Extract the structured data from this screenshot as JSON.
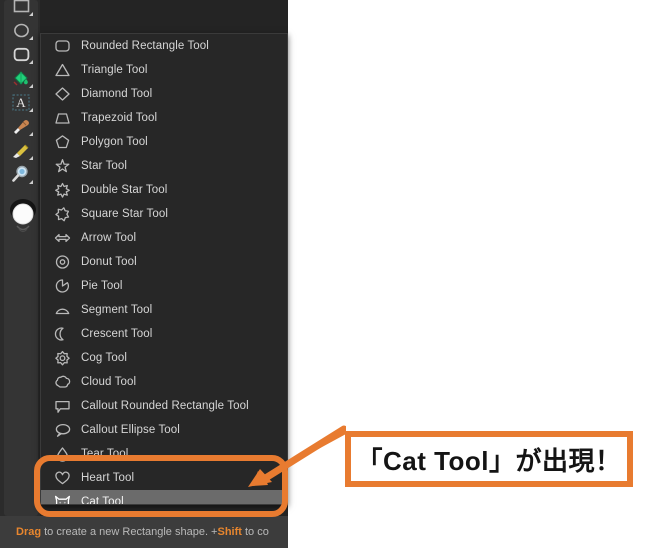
{
  "app": {
    "name": "shape-tool-flyout-menu",
    "panel_bg": "#272727",
    "accent_orange": "#e87b30",
    "selected_row_bg": "#6b6b6b"
  },
  "toolbar": {
    "name": "left-tool-palette",
    "tools": [
      {
        "id": "rectangle-tool",
        "icon": "rectangle-icon",
        "label": "Rectangle Tool"
      },
      {
        "id": "ellipse-tool",
        "icon": "ellipse-icon",
        "label": "Ellipse Tool"
      },
      {
        "id": "rounded-rectangle-tool",
        "icon": "rounded-rectangle-icon",
        "label": "Rounded Rectangle Tool"
      },
      {
        "id": "fill-tool",
        "icon": "fill-bucket-icon",
        "label": "Fill Tool"
      },
      {
        "id": "text-tool",
        "icon": "text-a-icon",
        "label": "Text Tool"
      },
      {
        "id": "paint-brush-tool",
        "icon": "paint-brush-icon",
        "label": "Paint Brush Tool"
      },
      {
        "id": "pencil-tool",
        "icon": "pencil-icon",
        "label": "Pencil Tool"
      },
      {
        "id": "zoom-tool",
        "icon": "magnifier-icon",
        "label": "Zoom Tool"
      }
    ],
    "color_swatch": {
      "name": "color-swatch",
      "fill": "#ffffff",
      "stroke": "#1a1a1a"
    }
  },
  "flyout_menu": {
    "name": "shape-tool-flyout",
    "items": [
      {
        "label": "Rounded Rectangle Tool",
        "icon": "rounded-rectangle-icon",
        "selected": false
      },
      {
        "label": "Triangle Tool",
        "icon": "triangle-icon",
        "selected": false
      },
      {
        "label": "Diamond Tool",
        "icon": "diamond-icon",
        "selected": false
      },
      {
        "label": "Trapezoid Tool",
        "icon": "trapezoid-icon",
        "selected": false
      },
      {
        "label": "Polygon Tool",
        "icon": "pentagon-icon",
        "selected": false
      },
      {
        "label": "Star Tool",
        "icon": "star-icon",
        "selected": false
      },
      {
        "label": "Double Star Tool",
        "icon": "double-star-icon",
        "selected": false
      },
      {
        "label": "Square Star Tool",
        "icon": "square-star-icon",
        "selected": false
      },
      {
        "label": "Arrow Tool",
        "icon": "double-arrow-icon",
        "selected": false
      },
      {
        "label": "Donut Tool",
        "icon": "donut-icon",
        "selected": false
      },
      {
        "label": "Pie Tool",
        "icon": "pie-icon",
        "selected": false
      },
      {
        "label": "Segment Tool",
        "icon": "segment-icon",
        "selected": false
      },
      {
        "label": "Crescent Tool",
        "icon": "crescent-icon",
        "selected": false
      },
      {
        "label": "Cog Tool",
        "icon": "cog-icon",
        "selected": false
      },
      {
        "label": "Cloud Tool",
        "icon": "cloud-icon",
        "selected": false
      },
      {
        "label": "Callout Rounded Rectangle Tool",
        "icon": "callout-rounded-rectangle-icon",
        "selected": false
      },
      {
        "label": "Callout Ellipse Tool",
        "icon": "callout-ellipse-icon",
        "selected": false
      },
      {
        "label": "Tear Tool",
        "icon": "tear-icon",
        "selected": false
      },
      {
        "label": "Heart Tool",
        "icon": "heart-icon",
        "selected": false
      },
      {
        "label": "Cat Tool",
        "icon": "cat-icon",
        "selected": true
      }
    ]
  },
  "status_bar": {
    "name": "status-hint-bar",
    "prefix": "Drag",
    "text": " to create a new Rectangle shape. +",
    "bold": "Shift",
    "suffix": " to co"
  },
  "annotation": {
    "callout_text": "「Cat Tool」が出現！",
    "highlight_target": "Cat Tool",
    "arrow": "orange-arrow",
    "color": "#e87b30"
  }
}
